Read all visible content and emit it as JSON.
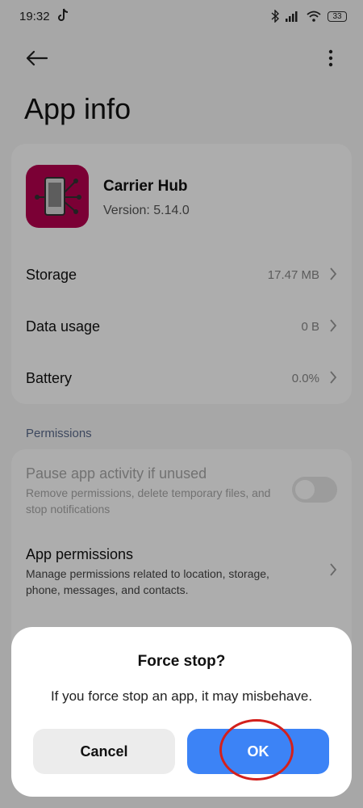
{
  "status_bar": {
    "time": "19:32",
    "battery": "33"
  },
  "page": {
    "title": "App info"
  },
  "app": {
    "name": "Carrier Hub",
    "version": "Version: 5.14.0",
    "icon_color": "#b5004e"
  },
  "rows": [
    {
      "label": "Storage",
      "value": "17.47 MB"
    },
    {
      "label": "Data usage",
      "value": "0 B"
    },
    {
      "label": "Battery",
      "value": "0.0%"
    }
  ],
  "permissions": {
    "section_label": "Permissions",
    "pause": {
      "title": "Pause app activity if unused",
      "desc": "Remove permissions, delete temporary files, and stop notifications",
      "enabled": false
    },
    "app_permissions": {
      "title": "App permissions",
      "desc": "Manage permissions related to location, storage, phone, messages, and contacts."
    }
  },
  "dialog": {
    "title": "Force stop?",
    "message": "If you force stop an app, it may misbehave.",
    "cancel_label": "Cancel",
    "ok_label": "OK"
  },
  "colors": {
    "accent": "#3c83f6",
    "highlight": "#d3201c"
  }
}
